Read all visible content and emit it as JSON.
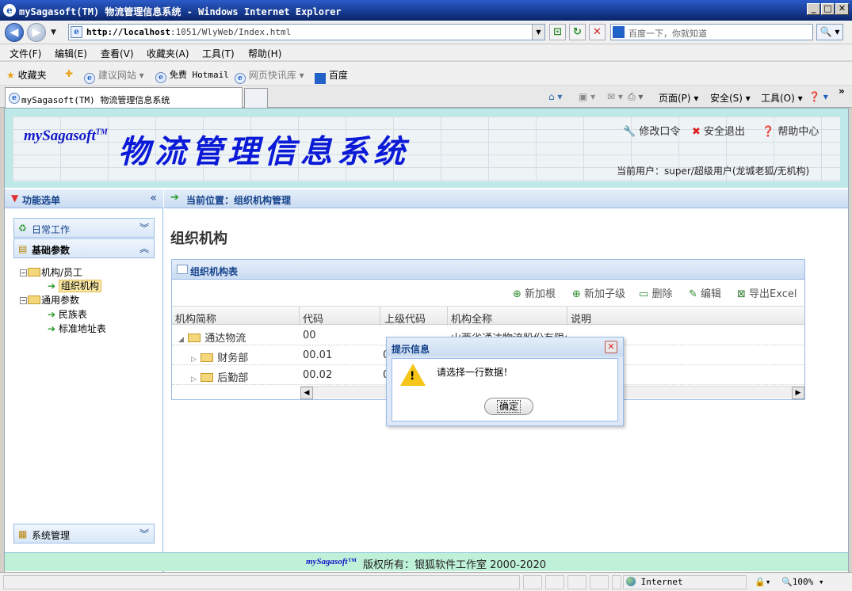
{
  "window": {
    "title": "mySagasoft(TM) 物流管理信息系统 - Windows Internet Explorer",
    "min": "_",
    "max": "□",
    "close": "✕"
  },
  "address": {
    "url_host": "http://localhost",
    "url_path": ":1051/WlyWeb/Index.html",
    "search_placeholder": "百度一下，你就知道"
  },
  "menu": [
    "文件(F)",
    "编辑(E)",
    "查看(V)",
    "收藏夹(A)",
    "工具(T)",
    "帮助(H)"
  ],
  "favorites": {
    "label": "收藏夹",
    "items": [
      "建议网站 ▾",
      "免费 Hotmail",
      "网页快讯库 ▾",
      "百度"
    ]
  },
  "tab": {
    "title": "mySagasoft(TM) 物流管理信息系统"
  },
  "commands": {
    "page": "页面(P) ▾",
    "safety": "安全(S) ▾",
    "tools": "工具(O) ▾",
    "more": "»"
  },
  "header": {
    "logo": "mySagasoft",
    "logo_tm": "TM",
    "system_title": "物流管理信息系统",
    "links": {
      "change_password": "修改口令",
      "logout": "安全退出",
      "help": "帮助中心"
    },
    "current_user": "当前用户：super/超级用户(龙城老狐/无机构)"
  },
  "sidebar": {
    "title": "功能选单",
    "sections": {
      "daily": "日常工作",
      "basic": "基础参数",
      "system": "系统管理"
    },
    "tree": {
      "org_staff": "机构/员工",
      "org": "组织机构",
      "common": "通用参数",
      "ethnic": "民族表",
      "address": "标准地址表"
    }
  },
  "main": {
    "breadcrumb": "当前位置：组织机构管理",
    "page_title": "组织机构",
    "grid": {
      "title": "组织机构表",
      "toolbar": {
        "add_root": "新加根",
        "add_child": "新加子级",
        "delete": "删除",
        "edit": "编辑",
        "export": "导出Excel"
      },
      "columns": [
        "机构简称",
        "代码",
        "上级代码",
        "机构全称",
        "说明"
      ],
      "rows": [
        {
          "name": "通达物流",
          "code": "00",
          "parent": "",
          "full": "山西省通达物流股份有限公"
        },
        {
          "name": "财务部",
          "code": "00.01",
          "parent": "0",
          "full": ""
        },
        {
          "name": "后勤部",
          "code": "00.02",
          "parent": "0",
          "full": ""
        }
      ]
    }
  },
  "dialog": {
    "title": "提示信息",
    "message": "请选择一行数据！",
    "ok": "确定"
  },
  "footer": {
    "logo": "mySagasoft™",
    "copyright": "版权所有：银狐软件工作室 2000-2020"
  },
  "statusbar": {
    "zone": "Internet",
    "zoom": "100%"
  }
}
